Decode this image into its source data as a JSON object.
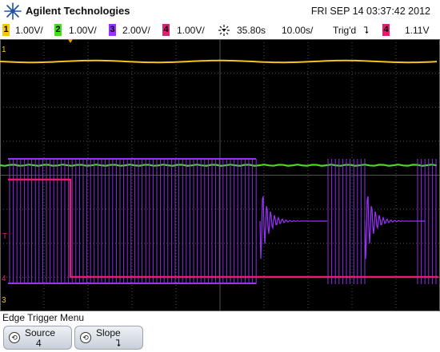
{
  "header": {
    "brand": "Agilent Technologies",
    "datetime": "FRI SEP 14 03:37:42 2012"
  },
  "status": {
    "channels": [
      {
        "num": "1",
        "scale": "1.00V/",
        "color": "#f5c518"
      },
      {
        "num": "2",
        "scale": "1.00V/",
        "color": "#44dd22"
      },
      {
        "num": "3",
        "scale": "2.00V/",
        "color": "#9b30ff"
      },
      {
        "num": "4",
        "scale": "1.00V/",
        "color": "#e0206e"
      }
    ],
    "time_delay": "35.80s",
    "time_scale": "10.00s/",
    "trigger_state": "Trig'd",
    "trigger_slope_symbol": "⮧",
    "trigger_source": "4",
    "trigger_level": "1.11V"
  },
  "screen": {
    "markers": {
      "ch1": "1",
      "ch4": "4",
      "ch3": "3",
      "trigger": "T"
    }
  },
  "menu": {
    "title": "Edge Trigger Menu",
    "softkeys": [
      {
        "label": "Source",
        "value": "4",
        "icon": "rotate-knob-icon"
      },
      {
        "label": "Slope",
        "value": "⮧",
        "icon": "rotate-knob-icon"
      }
    ]
  }
}
